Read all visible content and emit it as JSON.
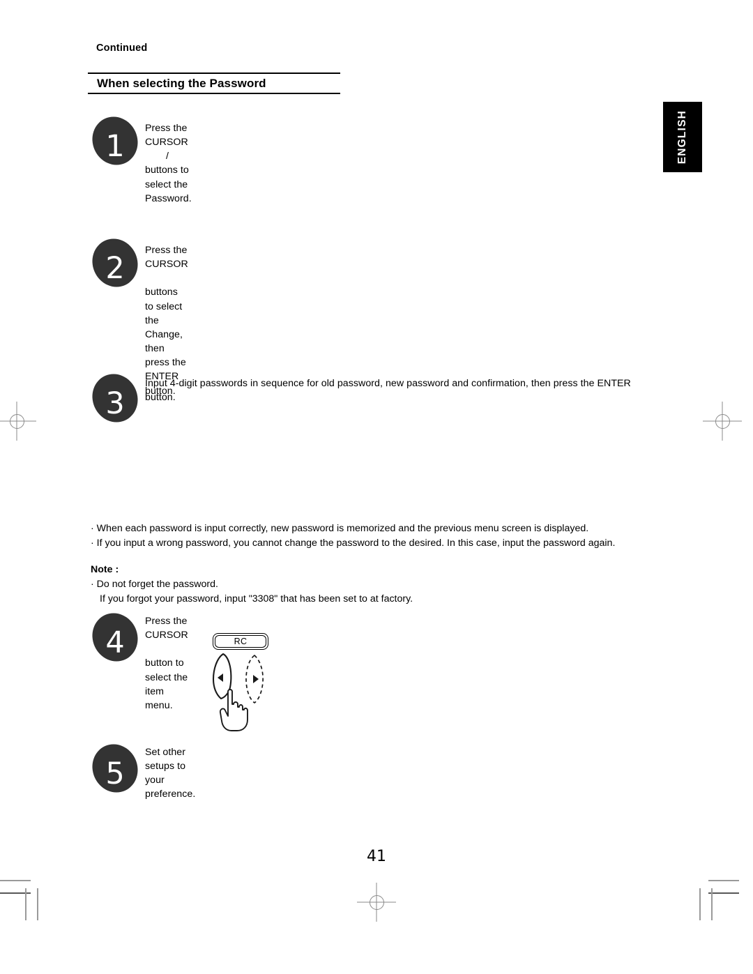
{
  "document": {
    "continued_label": "Continued",
    "section_title": "When selecting the Password",
    "language_tab": "ENGLISH",
    "page_number": "41"
  },
  "steps": [
    {
      "number": "1",
      "text_before": "Press the CURSOR",
      "separator": "/",
      "text_after": "buttons to select the Password."
    },
    {
      "number": "2",
      "text_before": "Press the CURSOR",
      "separator": "",
      "text_after": "buttons to select the Change, then press the ENTER button."
    },
    {
      "number": "3",
      "text_before": "Input 4-digit passwords in sequence for old password, new password and confirmation, then press the ENTER button.",
      "separator": "",
      "text_after": ""
    },
    {
      "number": "4",
      "text_before": "Press the CURSOR",
      "separator": "",
      "text_after": "button to select the item menu."
    },
    {
      "number": "5",
      "text_before": "Set other setups to your preference.",
      "separator": "",
      "text_after": ""
    }
  ],
  "notes": {
    "bullets": [
      "· When each password is input correctly, new password is memorized and the previous menu screen is displayed.",
      "· If you input a wrong password, you cannot change the password to the desired. In this case, input the password again."
    ],
    "note_heading": "Note :",
    "note_lines": [
      "· Do not forget the password.",
      "If you forgot your password, input \"3308\" that has been set to at factory."
    ]
  },
  "rc_diagram": {
    "label": "RC",
    "left_button_icon": "left-arrow-icon",
    "right_button_icon": "right-arrow-icon",
    "hand_icon": "pointing-hand-icon"
  },
  "colors": {
    "badge_fill": "#333333",
    "tab_background": "#000000",
    "tab_text": "#ffffff",
    "reg_mark": "#8a8a8a"
  }
}
